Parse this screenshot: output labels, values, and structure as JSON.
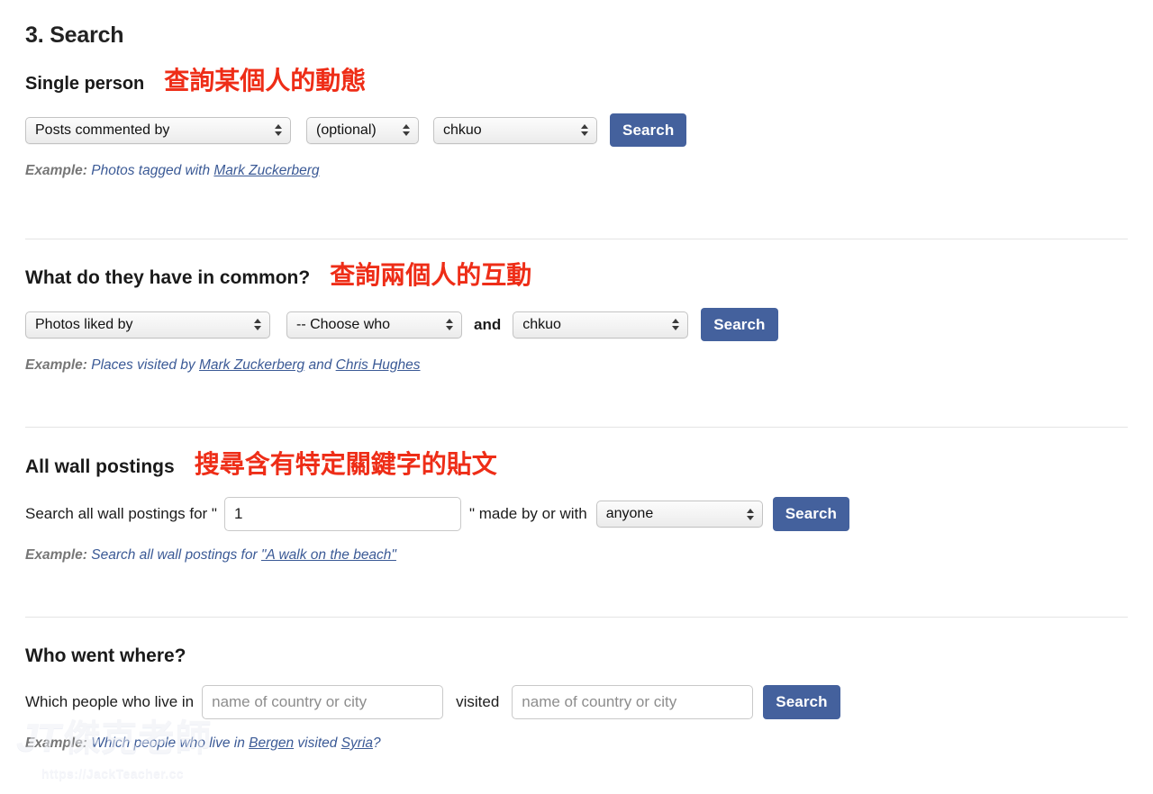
{
  "page": {
    "title": "3. Search"
  },
  "sections": {
    "single": {
      "heading": "Single person",
      "annotation": "查詢某個人的動態",
      "action_select": {
        "value": "Posts commented by"
      },
      "optional_select": {
        "value": "(optional)"
      },
      "person_select": {
        "value": "chkuo"
      },
      "search_button": "Search",
      "example": {
        "label": "Example:",
        "before": "Photos tagged with ",
        "link": "Mark Zuckerberg"
      }
    },
    "common": {
      "heading": "What do they have in common?",
      "annotation": "查詢兩個人的互動",
      "action_select": {
        "value": "Photos liked by"
      },
      "person_a_select": {
        "value": "-- Choose who"
      },
      "conjunction": "and",
      "person_b_select": {
        "value": "chkuo"
      },
      "search_button": "Search",
      "example": {
        "label": "Example:",
        "before": "Places visited by ",
        "link1": "Mark Zuckerberg",
        "middle": " and ",
        "link2": "Chris Hughes"
      }
    },
    "wall": {
      "heading": "All wall postings",
      "annotation": "搜尋含有特定關鍵字的貼文",
      "prefix_label": "Search all wall postings for \"",
      "keyword_input": {
        "value": "1",
        "placeholder": ""
      },
      "suffix_label": "\" made by or with",
      "who_select": {
        "value": "anyone"
      },
      "search_button": "Search",
      "example": {
        "label": "Example:",
        "before": "Search all wall postings for ",
        "link": "\"A walk on the beach\""
      }
    },
    "where": {
      "heading": "Who went where?",
      "prefix_label": "Which people who live in",
      "origin_input": {
        "value": "",
        "placeholder": "name of country or city"
      },
      "middle_label": "visited",
      "destination_input": {
        "value": "",
        "placeholder": "name of country or city"
      },
      "search_button": "Search",
      "example": {
        "label": "Example:",
        "before": "Which people who live in ",
        "link1": "Bergen",
        "middle": " visited ",
        "link2": "Syria",
        "after": "?"
      }
    }
  },
  "watermark": {
    "logo": "JT",
    "name": "傑克老師",
    "url": "https://JackTeacher.cc"
  },
  "colors": {
    "accent_button": "#44619d",
    "annotation_red": "#ee2d17",
    "link_blue": "#3b5a96",
    "divider": "#e4e4e4"
  }
}
